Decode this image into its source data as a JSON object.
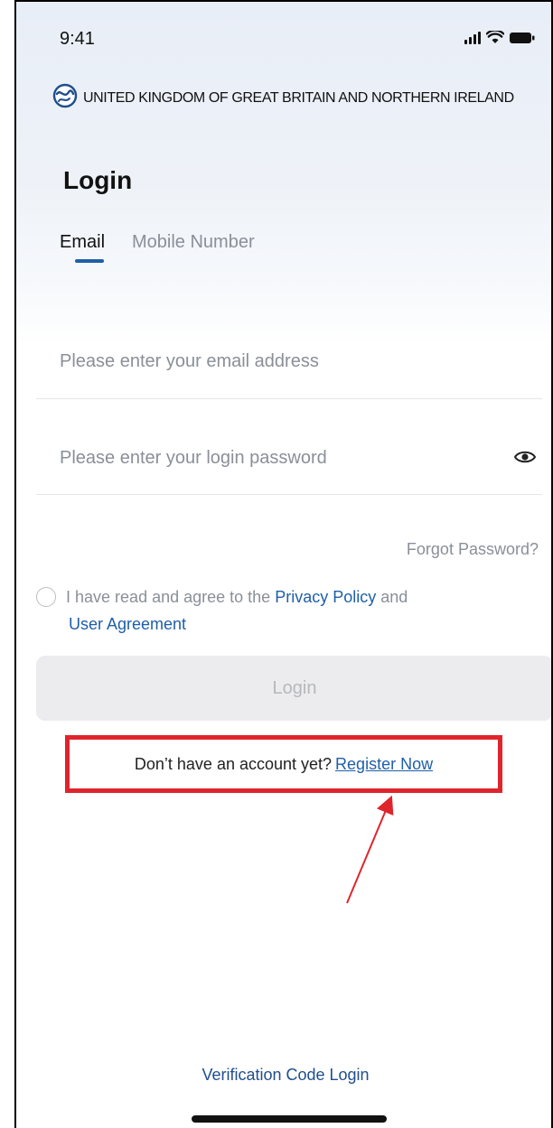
{
  "status_bar": {
    "time": "9:41",
    "icons": [
      "signal-icon",
      "wifi-icon",
      "battery-icon"
    ]
  },
  "region": {
    "icon": "globe-icon",
    "name": "UNITED KINGDOM OF GREAT BRITAIN AND NORTHERN IRELAND"
  },
  "page": {
    "title": "Login"
  },
  "tabs": [
    {
      "label": "Email",
      "active": true
    },
    {
      "label": "Mobile Number",
      "active": false
    }
  ],
  "form": {
    "email": {
      "value": "",
      "placeholder": "Please enter your email address"
    },
    "password": {
      "value": "",
      "placeholder": "Please enter your login password",
      "icon": "eye-icon"
    },
    "forgot_password": "Forgot Password?"
  },
  "agreement": {
    "prefix": "I have read and agree to the",
    "privacy_policy": "Privacy Policy",
    "conjunction": "and",
    "user_agreement": "User Agreement",
    "checked": false
  },
  "login_button": "Login",
  "register": {
    "prompt": "Don’t have an account yet?",
    "link": "Register Now"
  },
  "verification_login": "Verification Code Login",
  "colors": {
    "accent": "#1f5fa8",
    "highlight_box": "#e0242c",
    "arrow": "#e0242c"
  }
}
